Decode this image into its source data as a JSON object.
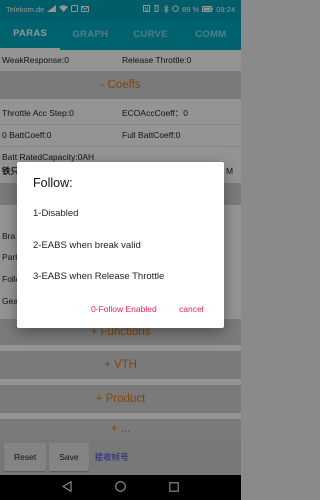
{
  "status_bar": {
    "carrier": "Telekom.de",
    "battery": "89 %",
    "time": "09:24"
  },
  "tabs": [
    {
      "label": "PARAS",
      "active": true
    },
    {
      "label": "GRAPH",
      "active": false
    },
    {
      "label": "CURVE",
      "active": false
    },
    {
      "label": "COMM",
      "active": false
    }
  ],
  "params": {
    "weak_response": "WeakResponse:0",
    "release_throttle": "Release Throttle:0",
    "coeffs_header": "- Coeffs",
    "throttle_acc_step": "Throttle Acc Step:0",
    "eco_acc_coeff": "ECOAccCoeff：0",
    "zero_batt_coeff": "0 BattCoeff:0",
    "full_batt_coeff": "Full BattCoeff:0",
    "batt_rated_capacity": "Batt RatedCapacity:0AH",
    "row_partial_left": "铁只程",
    "row_partial_right": "M",
    "left_cut_1": "Bra",
    "left_cut_2": "Park",
    "left_cut_3": "Follo",
    "left_cut_4": "Gea",
    "functions_header": "+ Functions",
    "vth_header": "+ VTH",
    "product_header": "+ Product",
    "bottom_partial": "+ ..."
  },
  "bottom_bar": {
    "reset_label": "Reset",
    "save_label": "Save",
    "receive_label": "接收帧号"
  },
  "dialog": {
    "title": "Follow:",
    "options": [
      "1-Disabled",
      "2-EABS when break valid",
      "3-EABS when Release Throttle"
    ],
    "positive_label": "0-Follow Enabled",
    "negative_label": "cancel"
  },
  "colors": {
    "accent": "#03a9c0",
    "section_text": "#e0770a",
    "dialog_button": "#e91e63",
    "receive_text": "#3b3bd6"
  }
}
